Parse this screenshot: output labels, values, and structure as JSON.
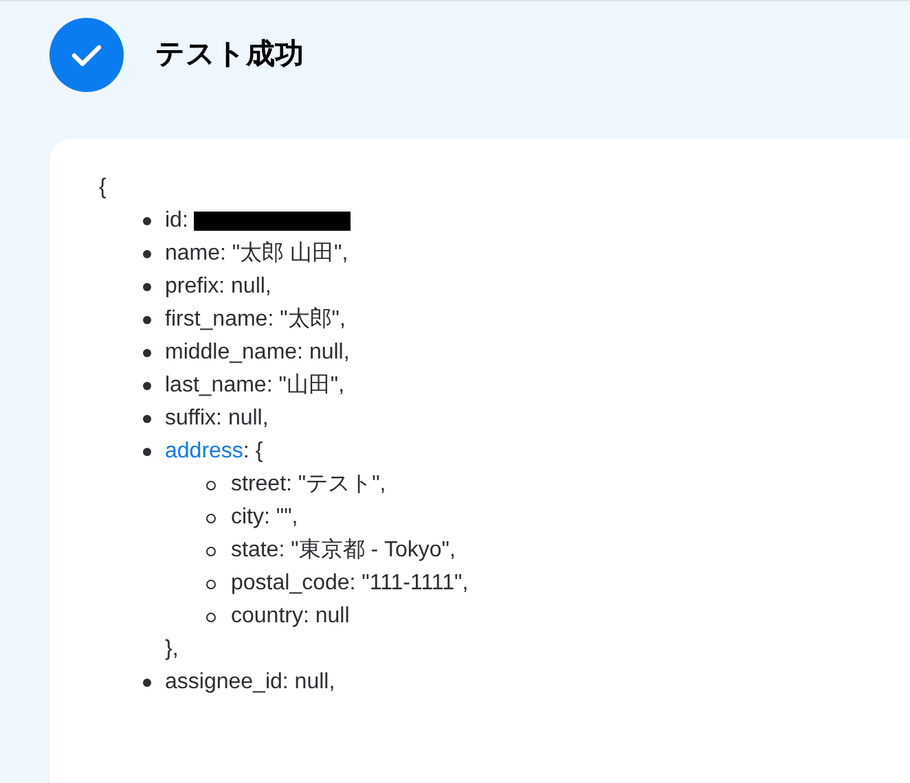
{
  "header": {
    "success": true,
    "title": "テスト成功"
  },
  "result": {
    "open": "{",
    "items": [
      {
        "kind": "field",
        "text": "id:",
        "redacted": true
      },
      {
        "kind": "field",
        "text": "name: \"太郎 山田\","
      },
      {
        "kind": "field",
        "text": "prefix: null,"
      },
      {
        "kind": "field",
        "text": "first_name: \"太郎\","
      },
      {
        "kind": "field",
        "text": "middle_name: null,"
      },
      {
        "kind": "field",
        "text": "last_name: \"山田\","
      },
      {
        "kind": "field",
        "text": "suffix: null,"
      },
      {
        "kind": "object",
        "key": "address",
        "text": ": {",
        "close": "},",
        "children": [
          {
            "kind": "field",
            "text": "street: \"テスト\","
          },
          {
            "kind": "field",
            "text": "city: \"\","
          },
          {
            "kind": "field",
            "text": "state: \"東京都 - Tokyo\","
          },
          {
            "kind": "field",
            "text": "postal_code: \"111-1111\","
          },
          {
            "kind": "field",
            "text": "country: null"
          }
        ]
      },
      {
        "kind": "field",
        "text": "assignee_id: null,"
      }
    ]
  }
}
